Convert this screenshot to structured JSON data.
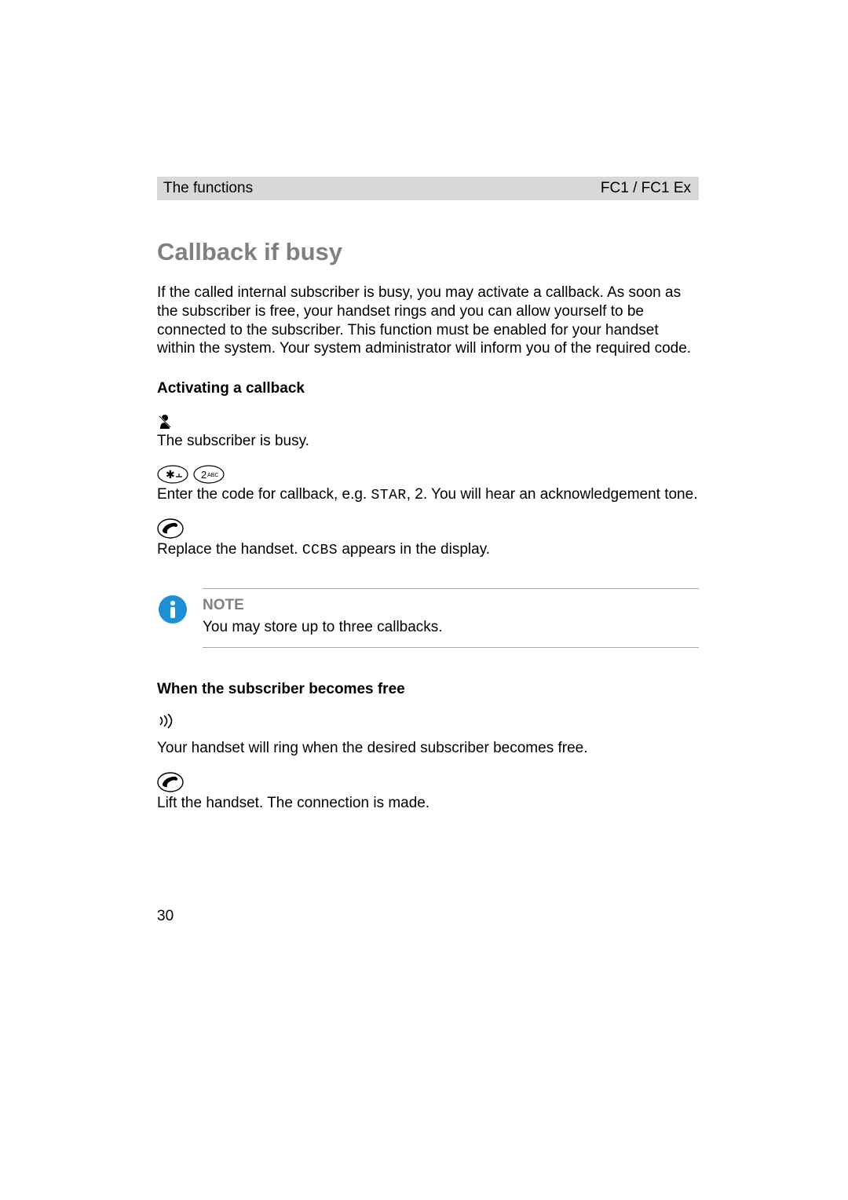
{
  "header": {
    "left": "The functions",
    "right": "FC1 / FC1 Ex"
  },
  "title": "Callback if busy",
  "intro": "If the called internal subscriber is busy, you may activate a callback. As soon as the subscriber is free, your handset rings and you can allow yourself to be connected to the subscriber. This function must be enabled for your handset within the system. Your system administrator will inform you of the required code.",
  "sub1": "Activating a callback",
  "step1": "The subscriber is busy.",
  "step2a": "Enter the code for callback, e.g. ",
  "step2b": ", 2. You will hear an acknowledgement tone.",
  "step2code": "STAR",
  "step3a": "Replace the handset. ",
  "step3b": " appears in the display.",
  "step3code": "CCBS",
  "note": {
    "label": "NOTE",
    "text": "You may store up to three callbacks."
  },
  "sub2": "When the subscriber becomes free",
  "step4": "Your handset will ring when the desired subscriber becomes free.",
  "step5": "Lift the handset. The connection is made.",
  "pageNumber": "30"
}
